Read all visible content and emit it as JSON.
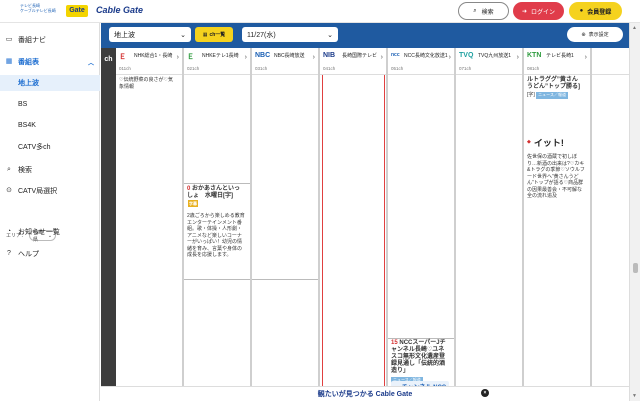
{
  "header": {
    "logo1_line1": "テレビ長崎",
    "logo1_line2": "ケーブルテレビ長崎",
    "logo2": "Gate",
    "brand": "Cable Gate",
    "search_label": "検索",
    "login_label": "ログイン",
    "register_label": "会員登録"
  },
  "sidebar": {
    "items": [
      {
        "label": "番組ナビ",
        "icon": "tv-icon"
      },
      {
        "label": "番組表",
        "icon": "grid-icon"
      },
      {
        "label": "地上波"
      },
      {
        "label": "BS"
      },
      {
        "label": "BS4K"
      },
      {
        "label": "CATV多ch"
      },
      {
        "label": "検索",
        "icon": "search-icon"
      },
      {
        "label": "CATV局選択",
        "icon": "antenna-icon"
      },
      {
        "label": "お知らせ一覧",
        "icon": "bell-icon"
      },
      {
        "label": "ヘルプ",
        "icon": "help-icon"
      }
    ],
    "area_label": "エリア：",
    "area_value": "長崎県"
  },
  "controls": {
    "broadcast_value": "地上波",
    "ch_list_label": "ch一覧",
    "date_value": "11/27(水)",
    "display_settings_label": "表示設定"
  },
  "grid": {
    "ch_label": "ch",
    "channels": [
      {
        "logo": "Ｅ",
        "name": "NHK総合1・長崎",
        "num": "011ch",
        "color": "#d32f2f"
      },
      {
        "logo": "Ｅ",
        "name": "NHKEテレ1長崎",
        "num": "021ch",
        "color": "#2e9b3e"
      },
      {
        "logo": "NBC",
        "name": "NBC長崎放送",
        "num": "031ch",
        "color": "#1a5fb4"
      },
      {
        "logo": "NIB",
        "name": "長崎国際テレビ",
        "num": "041ch",
        "color": "#1a3a8a"
      },
      {
        "logo": "ncc",
        "name": "NCC長崎文化放送1",
        "num": "051ch",
        "color": "#1a5fb4"
      },
      {
        "logo": "TVQ",
        "name": "TVQ九州放送1",
        "num": "071ch",
        "color": "#1ea0a0"
      },
      {
        "logo": "KTN",
        "name": "テレビ長崎1",
        "num": "081ch",
        "color": "#2e9b3e"
      }
    ],
    "programs": {
      "col1_top": "♡伝統野菜の良さが♡気象情報",
      "col2_time": "0",
      "col2_title": "おかあさんといっしょ　水曜日[字]",
      "col2_badge": "字幕",
      "col2_desc": "2歳ごろから楽しめる教育エンターテインメント番組。歌・体操・人形劇・アニメなど楽しいコーナーがいっぱい！幼児の情緒を育み、言葉や身体の成長を応援します。",
      "col5_time": "15",
      "col5_title": "NCCスーパーJチャンネル長崎♡ユネスコ無形文化遺産登録見通し「伝統的酒造り」",
      "col5_badge": "ニュース／報道",
      "col5_img": "チャンネル NCC長崎",
      "col7_top": "ルトラググ”黄さん うどん”トップ勝る]",
      "col7_badge1": "[字]",
      "col7_badge2": "ニュース／報道",
      "col7_img": "イット!",
      "col7_desc": "佐世保の酒蔵で初しぼり…新酒の出来は?♡カキ&トラグの季節♡ソウルフード世界へ”黄さんうどん”トップが語る♡商品群の因果最善会・不可解な全の流れ追及"
    }
  },
  "banner": {
    "text": "観たいが見つかる Cable Gate"
  }
}
